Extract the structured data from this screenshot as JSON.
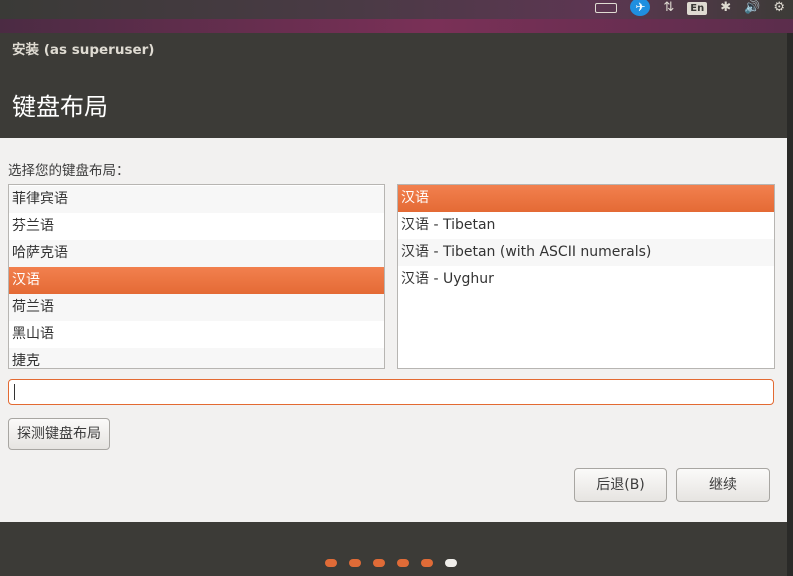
{
  "window": {
    "title": "安装 (as superuser)"
  },
  "page": {
    "title": "键盘布局",
    "prompt": "选择您的键盘布局："
  },
  "system_tray": {
    "language_indicator": "En",
    "accent_color": "#1f8fe0"
  },
  "layouts": [
    {
      "label": "菲律宾语",
      "selected": false
    },
    {
      "label": "芬兰语",
      "selected": false
    },
    {
      "label": "哈萨克语",
      "selected": false
    },
    {
      "label": "汉语",
      "selected": true
    },
    {
      "label": "荷兰语",
      "selected": false
    },
    {
      "label": "黑山语",
      "selected": false
    },
    {
      "label": "捷克",
      "selected": false
    }
  ],
  "variants": [
    {
      "label": "汉语",
      "selected": true
    },
    {
      "label": "汉语 - Tibetan",
      "selected": false
    },
    {
      "label": "汉语 - Tibetan (with ASCII numerals)",
      "selected": false
    },
    {
      "label": "汉语 - Uyghur",
      "selected": false
    }
  ],
  "test_input": {
    "value": "",
    "placeholder": ""
  },
  "buttons": {
    "detect": "探测键盘布局",
    "back": "后退(B)",
    "continue": "继续"
  },
  "progress": {
    "total_steps": 6,
    "current_step": 6
  },
  "colors": {
    "selection": "#e9703c",
    "header_bg": "#3c3b37",
    "content_bg": "#f2f1f0"
  }
}
